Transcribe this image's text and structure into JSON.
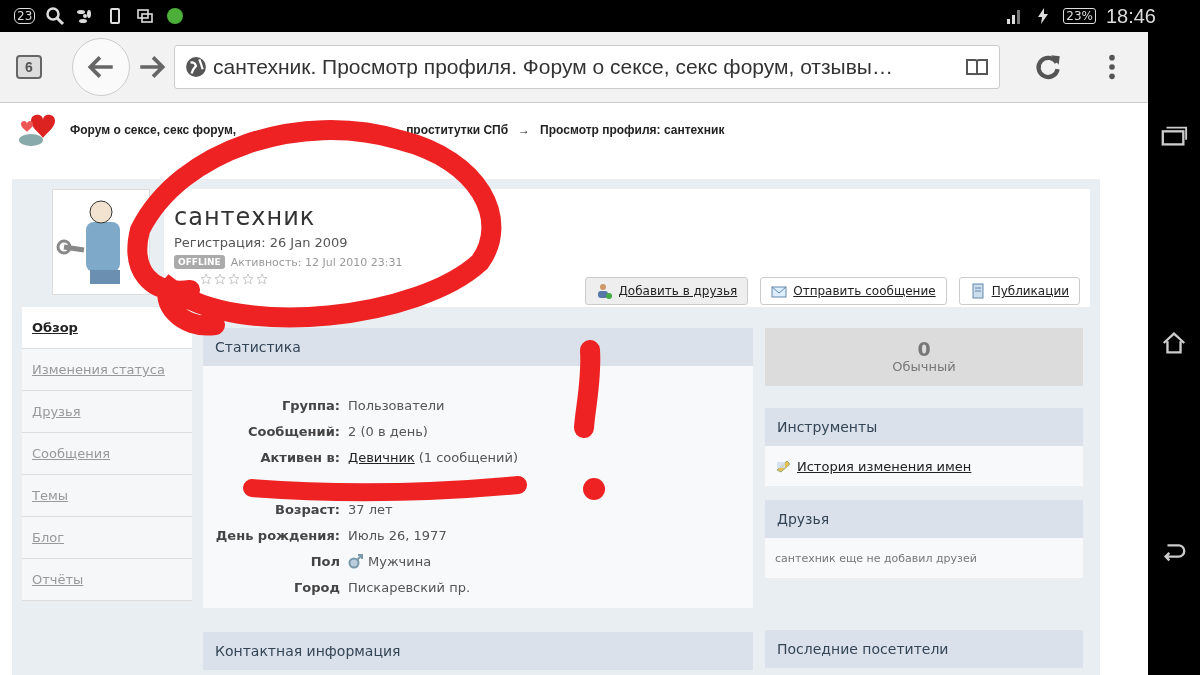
{
  "status_bar": {
    "notification_count": "23",
    "battery": "23%",
    "time": "18:46"
  },
  "browser": {
    "tab_count": "6",
    "url": "сантехник. Просмотр профиля. Форум о сексе, секс форум, отзывы…"
  },
  "breadcrumb": {
    "parts": [
      "Форум о сексе, секс форум,",
      "проститутки СПб"
    ],
    "separator": "→",
    "current": "Просмотр профиля: сантехник"
  },
  "profile": {
    "name": "сантехник",
    "registered": "Регистрация: 26 Jan 2009",
    "status_badge": "OFFLINE",
    "activity": "Активность: 12 Jul 2010 23:31",
    "stars": 0
  },
  "actions": [
    "Добавить в друзья",
    "Отправить сообщение",
    "Публикации"
  ],
  "sidebar": {
    "items": [
      {
        "label": "Обзор",
        "selected": true
      },
      {
        "label": "Изменения статуса",
        "selected": false
      },
      {
        "label": "Друзья",
        "selected": false
      },
      {
        "label": "Сообщения",
        "selected": false
      },
      {
        "label": "Темы",
        "selected": false
      },
      {
        "label": "Блог",
        "selected": false
      },
      {
        "label": "Отчёты",
        "selected": false
      }
    ]
  },
  "statistics": {
    "title": "Статистика",
    "rows": [
      {
        "kind": "text",
        "label": "Группа:",
        "value": "Пользователи"
      },
      {
        "kind": "text",
        "label": "Сообщений:",
        "value": "2 (0 в день)"
      },
      {
        "kind": "link",
        "label": "Активен в:",
        "link": "Девичник",
        "value": "(1 сообщений)"
      },
      {
        "kind": "hidden"
      },
      {
        "kind": "text",
        "label": "Возраст:",
        "value": "37 лет"
      },
      {
        "kind": "text",
        "label": "День рождения:",
        "value": "Июль 26, 1977"
      },
      {
        "kind": "gender",
        "label": "Пол",
        "value": "Мужчина"
      },
      {
        "kind": "text",
        "label": "Город",
        "value": "Пискаревский пр."
      }
    ]
  },
  "contact": {
    "title": "Контактная информация"
  },
  "reputation": {
    "value": "0",
    "label": "Обычный"
  },
  "tools": {
    "title": "Инструменты",
    "link": "История изменения имен"
  },
  "friends": {
    "title": "Друзья",
    "text": "сантехник еще не добавил друзей"
  },
  "visitors": {
    "title": "Последние посетители"
  }
}
